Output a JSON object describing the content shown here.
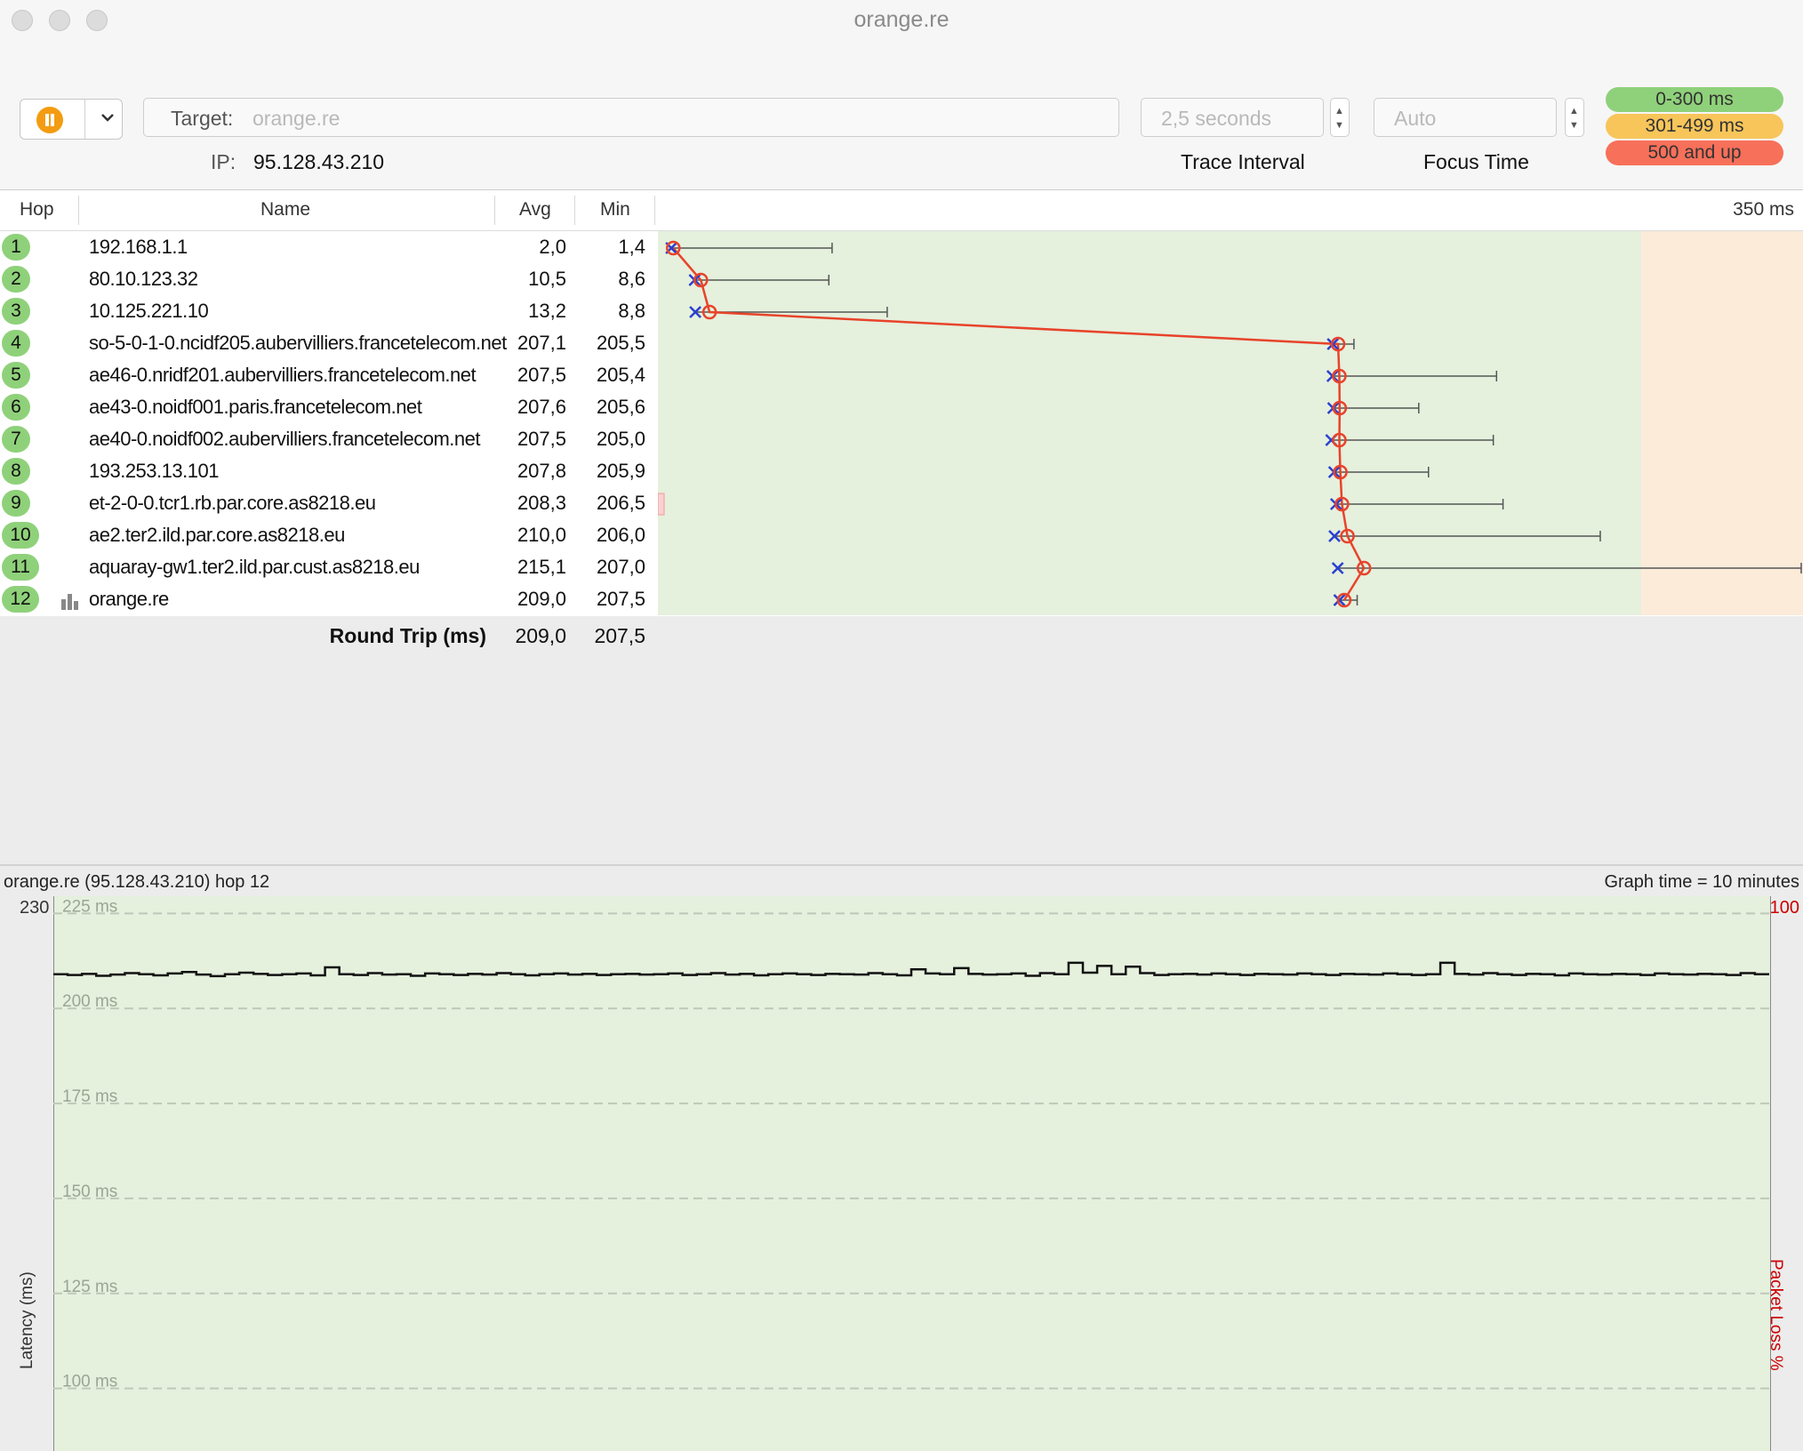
{
  "window": {
    "title": "orange.re"
  },
  "toolbar": {
    "target_label": "Target:",
    "target_placeholder": "orange.re",
    "ip_label": "IP:",
    "ip_value": "95.128.43.210",
    "interval_value": "2,5 seconds",
    "interval_caption": "Trace Interval",
    "focus_value": "Auto",
    "focus_caption": "Focus Time",
    "legend": [
      {
        "label": "0-300 ms",
        "color": "#8fd17a"
      },
      {
        "label": "301-499 ms",
        "color": "#f7c55a"
      },
      {
        "label": "500 and up",
        "color": "#f7705a"
      }
    ]
  },
  "table": {
    "headers": {
      "hop": "Hop",
      "name": "Name",
      "avg": "Avg",
      "min": "Min",
      "scale": "350 ms"
    },
    "rows": [
      {
        "hop": "1",
        "name": "192.168.1.1",
        "avg": "2,0",
        "min": "1,4"
      },
      {
        "hop": "2",
        "name": "80.10.123.32",
        "avg": "10,5",
        "min": "8,6"
      },
      {
        "hop": "3",
        "name": "10.125.221.10",
        "avg": "13,2",
        "min": "8,8"
      },
      {
        "hop": "4",
        "name": "so-5-0-1-0.ncidf205.aubervilliers.francetelecom.net",
        "avg": "207,1",
        "min": "205,5"
      },
      {
        "hop": "5",
        "name": "ae46-0.nridf201.aubervilliers.francetelecom.net",
        "avg": "207,5",
        "min": "205,4"
      },
      {
        "hop": "6",
        "name": "ae43-0.noidf001.paris.francetelecom.net",
        "avg": "207,6",
        "min": "205,6"
      },
      {
        "hop": "7",
        "name": "ae40-0.noidf002.aubervilliers.francetelecom.net",
        "avg": "207,5",
        "min": "205,0"
      },
      {
        "hop": "8",
        "name": "193.253.13.101",
        "avg": "207,8",
        "min": "205,9"
      },
      {
        "hop": "9",
        "name": "et-2-0-0.tcr1.rb.par.core.as8218.eu",
        "avg": "208,3",
        "min": "206,5"
      },
      {
        "hop": "10",
        "name": "ae2.ter2.ild.par.core.as8218.eu",
        "avg": "210,0",
        "min": "206,0"
      },
      {
        "hop": "11",
        "name": "aquaray-gw1.ter2.ild.par.cust.as8218.eu",
        "avg": "215,1",
        "min": "207,0"
      },
      {
        "hop": "12",
        "name": "orange.re",
        "avg": "209,0",
        "min": "207,5"
      }
    ],
    "footer": {
      "label": "Round Trip (ms)",
      "avg": "209,0",
      "min": "207,5"
    }
  },
  "route_chart": {
    "scale_max_ms": 350,
    "avg_ms": [
      2.0,
      10.5,
      13.2,
      207.1,
      207.5,
      207.6,
      207.5,
      207.8,
      208.3,
      210.0,
      215.1,
      209.0
    ],
    "min_ms": [
      1.4,
      8.6,
      8.8,
      205.5,
      205.4,
      205.6,
      205.0,
      205.9,
      206.5,
      206.0,
      207.0,
      207.5
    ],
    "max_ms": [
      51.0,
      50.0,
      68.0,
      212.0,
      256.0,
      232.0,
      255.0,
      235.0,
      258.0,
      288.0,
      350.0,
      213.0
    ],
    "avg_line_color": "#e8432a",
    "min_marker_color": "#2a3fd0"
  },
  "graph": {
    "header": "orange.re (95.128.43.210) hop 12",
    "graph_time": "Graph time = 10 minutes",
    "y_top": "230",
    "y_top_right": "100",
    "ylabel_left": "Latency (ms)",
    "ylabel_right": "Packet Loss %",
    "grid_labels": [
      "225 ms",
      "200 ms",
      "175 ms",
      "150 ms",
      "125 ms",
      "100 ms"
    ]
  },
  "chart_data": {
    "type": "line",
    "title": "",
    "xlabel": "",
    "ylabel": "Latency (ms)",
    "y2label": "Packet Loss %",
    "ylim": [
      84,
      230
    ],
    "y2lim": [
      0,
      100
    ],
    "series": [
      {
        "name": "",
        "values": [
          209.0,
          208.8,
          209.1,
          208.6,
          208.9,
          209.3,
          209.0,
          208.7,
          209.2,
          209.6,
          208.9,
          208.5,
          209.0,
          209.4,
          209.1,
          208.8,
          209.0,
          209.2,
          208.7,
          210.8,
          209.0,
          208.8,
          209.3,
          208.9,
          209.0,
          208.6,
          209.2,
          209.0,
          208.8,
          209.1,
          208.9,
          209.3,
          209.0,
          208.7,
          209.0,
          209.2,
          208.9,
          209.1,
          208.8,
          209.0,
          209.1,
          208.9,
          209.0,
          209.2,
          208.8,
          209.0,
          209.3,
          208.9,
          209.1,
          208.7,
          209.0,
          209.2,
          209.0,
          208.8,
          209.1,
          209.0,
          208.9,
          209.3,
          209.0,
          208.7,
          210.3,
          209.2,
          209.0,
          210.6,
          209.1,
          208.9,
          209.0,
          209.2,
          208.6,
          209.3,
          209.0,
          212.0,
          209.4,
          211.2,
          209.0,
          211.0,
          209.3,
          208.8,
          209.0,
          209.1,
          208.9,
          209.2,
          209.0,
          208.8,
          209.1,
          209.0,
          208.9,
          209.2,
          209.0,
          208.8,
          209.1,
          209.0,
          208.9,
          209.2,
          209.0,
          208.8,
          209.0,
          212.0,
          209.1,
          208.9,
          209.3,
          209.0,
          208.8,
          209.1,
          209.0,
          208.7,
          209.2,
          209.0,
          208.9,
          209.1,
          209.0,
          208.8,
          209.2,
          209.0,
          208.9,
          209.1,
          209.0,
          208.8,
          209.3,
          209.0
        ]
      }
    ]
  }
}
